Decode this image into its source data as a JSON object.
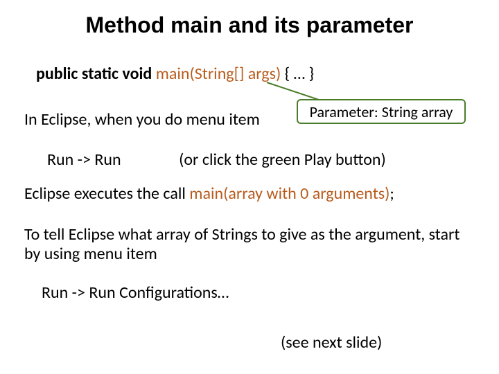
{
  "title": "Method main and its parameter",
  "code": {
    "kw": "public static void",
    "main_sig": "main(String[] args)",
    "tail": " { … }"
  },
  "callout": "Parameter: String array",
  "lines": {
    "eclipse_intro": "In Eclipse, when you do menu item",
    "run_run": "Run -> Run",
    "run_hint": "(or click the green Play button)",
    "exec_prefix": "Eclipse executes the call ",
    "exec_main_open": "main(",
    "exec_arg": "array with 0 arguments",
    "exec_main_close": ")",
    "exec_semicolon": ";",
    "tell": "To tell Eclipse what array of Strings to give as the argument, start by using menu item",
    "run_config": "Run -> Run Configurations…",
    "see_next": "(see next slide)"
  }
}
